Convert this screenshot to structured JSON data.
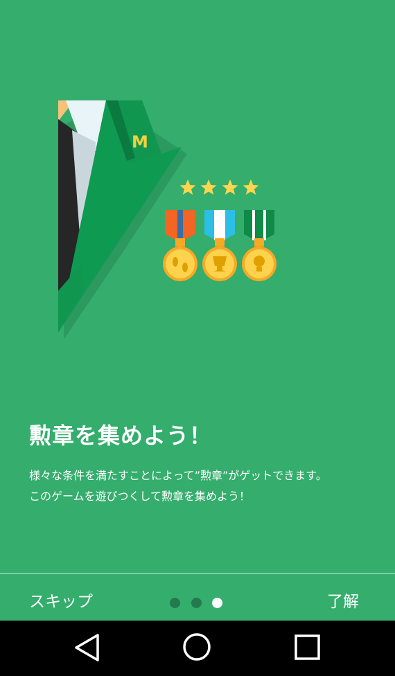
{
  "illustration": {
    "badge_letter": "M",
    "stars": 4,
    "medals": [
      {
        "name": "footprints",
        "ribbon_colors": [
          "#f26522",
          "#3a6ea5"
        ]
      },
      {
        "name": "trophy",
        "ribbon_colors": [
          "#2bbfe5",
          "#ffffff"
        ]
      },
      {
        "name": "lightbulb",
        "ribbon_colors": [
          "#0f8a47",
          "#ffffff"
        ]
      }
    ]
  },
  "content": {
    "title": "勲章を集めよう！",
    "description_line1": "様々な条件を満たすことによって”勲章”がゲットできます。",
    "description_line2": "このゲームを遊びつくして勲章を集めよう！"
  },
  "footer": {
    "skip_label": "スキップ",
    "ok_label": "了解",
    "page_count": 3,
    "current_page": 3
  },
  "navbar": {
    "icons": [
      "back-icon",
      "home-icon",
      "recent-apps-icon"
    ]
  },
  "colors": {
    "background": "#34ad6d",
    "dot_inactive": "#237a4d",
    "dot_active": "#ffffff",
    "star": "#ffd54f",
    "medal_gold": "#fbc02d"
  }
}
